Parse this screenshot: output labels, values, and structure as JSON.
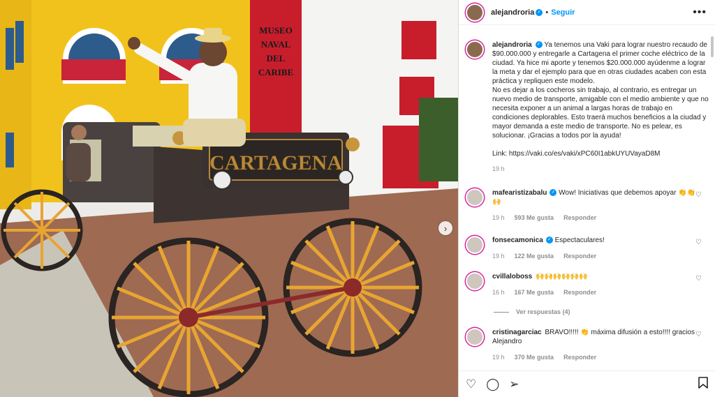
{
  "post": {
    "author": "alejandroria",
    "follow_label": "Seguir",
    "more_label": "•••",
    "sign_text": "CARTAGENA",
    "building_sign": "MUSEO\nNAVAL\nDEL\nCARIBE",
    "caption": "Ya tenemos una Vaki para lograr nuestro recaudo de $90.000.000 y entregarle a Cartagena el primer coche eléctrico de la ciudad. Ya hice mi aporte y tenemos $20.000.000 ayúdenme a lograr la meta y dar el ejemplo para que en otras ciudades acaben con esta práctica y repliquen este modelo.\nNo es dejar a los cocheros sin trabajo, al contrario, es entregar un nuevo medio de transporte, amigable con el medio ambiente y que no necesita exponer a un animal a largas horas de trabajo en condiciones deplorables. Esto traerá muchos beneficios a la ciudad y mayor demanda a este medio de transporte. No es pelear, es solucionar. ¡Gracias a todos por la ayuda!",
    "link": "Link: https://vaki.co/es/vaki/xPC60I1abkUYUVayaD8M",
    "time": "19 h"
  },
  "comments": [
    {
      "user": "mafearistizabalu",
      "text": "Wow! Iniciativas que debemos apoyar",
      "emoji": "👏👏🙌",
      "time": "19 h",
      "likes": "593 Me gusta",
      "reply": "Responder"
    },
    {
      "user": "fonsecamonica",
      "text": "Espectaculares!",
      "emoji": "",
      "time": "19 h",
      "likes": "122 Me gusta",
      "reply": "Responder"
    },
    {
      "user": "cvillaloboss",
      "text": "",
      "emoji": "🙌🙌🙌🙌🙌🙌",
      "time": "16 h",
      "likes": "167 Me gusta",
      "reply": "Responder",
      "view_replies": "Ver respuestas (4)"
    },
    {
      "user": "cristinagarciac",
      "text": "BRAVO!!!!!  👏 máxima difusión a esto!!!! gracios Alejandro",
      "emoji": "",
      "time": "19 h",
      "likes": "370 Me gusta",
      "reply": "Responder"
    }
  ],
  "icons": {
    "like": "heart-outline-icon",
    "comment": "comment-bubble-icon",
    "share": "paper-plane-icon",
    "save": "bookmark-icon",
    "next": "chevron-right-icon"
  },
  "colors": {
    "accent": "#0095f6",
    "muted": "#8e8e8e"
  }
}
